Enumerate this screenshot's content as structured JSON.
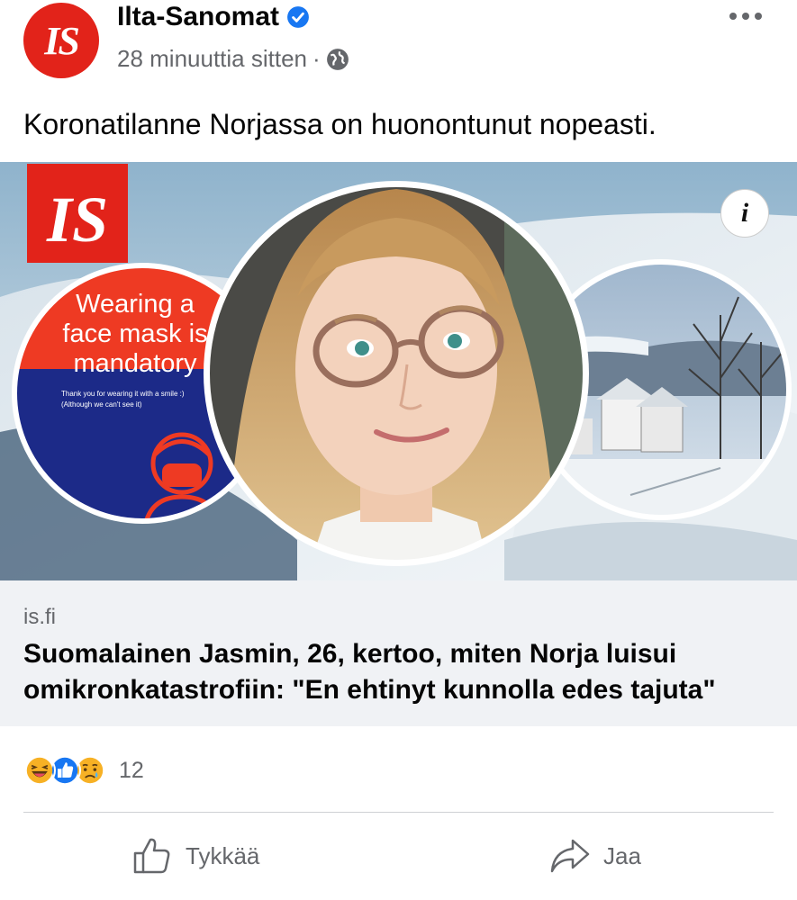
{
  "post": {
    "page_name": "Ilta-Sanomat",
    "logo_text": "IS",
    "timestamp": "28 minuuttia sitten",
    "separator": "·",
    "caption": "Koronatilanne Norjassa on huonontunut nopeasti.",
    "image": {
      "badge_text": "IS",
      "sign_text_line1": "Wearing a",
      "sign_text_line2": "face mask is",
      "sign_text_line3": "mandatory",
      "sign_small_line1": "Thank you for wearing it with a smile :)",
      "sign_small_line2": "(Although we can't see it)"
    },
    "info_glyph": "i",
    "link": {
      "domain": "is.fi",
      "headline": "Suomalainen Jasmin, 26, kertoo, miten Norja luisui omikronkatastrofiin: \"En ehtinyt kunnolla edes tajuta\""
    },
    "reactions": {
      "icons": [
        "haha-icon",
        "like-icon",
        "sad-icon"
      ],
      "count": "12"
    },
    "actions": {
      "like_label": "Tykkää",
      "share_label": "Jaa"
    }
  },
  "colors": {
    "brand_red": "#e2231a",
    "facebook_blue": "#1877f2",
    "secondary_text": "#65676b",
    "link_box_bg": "#f0f2f5"
  }
}
